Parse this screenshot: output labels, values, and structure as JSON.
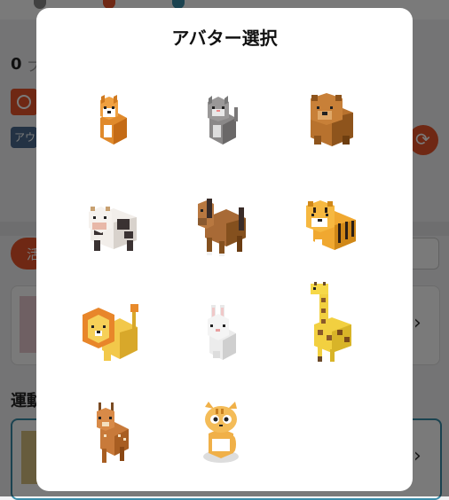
{
  "background": {
    "count_value": "0",
    "count_suffix": "フ",
    "badge_blue_text": "アウ",
    "pill_text": "活",
    "section_title": "運動"
  },
  "modal": {
    "title": "アバター選択"
  },
  "avatars": [
    {
      "icon": "shiba-dog-icon"
    },
    {
      "icon": "gray-cat-icon"
    },
    {
      "icon": "brown-bear-icon"
    },
    {
      "icon": "cow-icon"
    },
    {
      "icon": "horse-icon"
    },
    {
      "icon": "tiger-icon"
    },
    {
      "icon": "lion-icon"
    },
    {
      "icon": "rabbit-icon"
    },
    {
      "icon": "giraffe-icon"
    },
    {
      "icon": "deer-icon"
    },
    {
      "icon": "tabby-kitten-icon"
    }
  ],
  "colors": {
    "accent": "#e8552b",
    "overlay": "rgba(0,0,0,0.52)"
  }
}
